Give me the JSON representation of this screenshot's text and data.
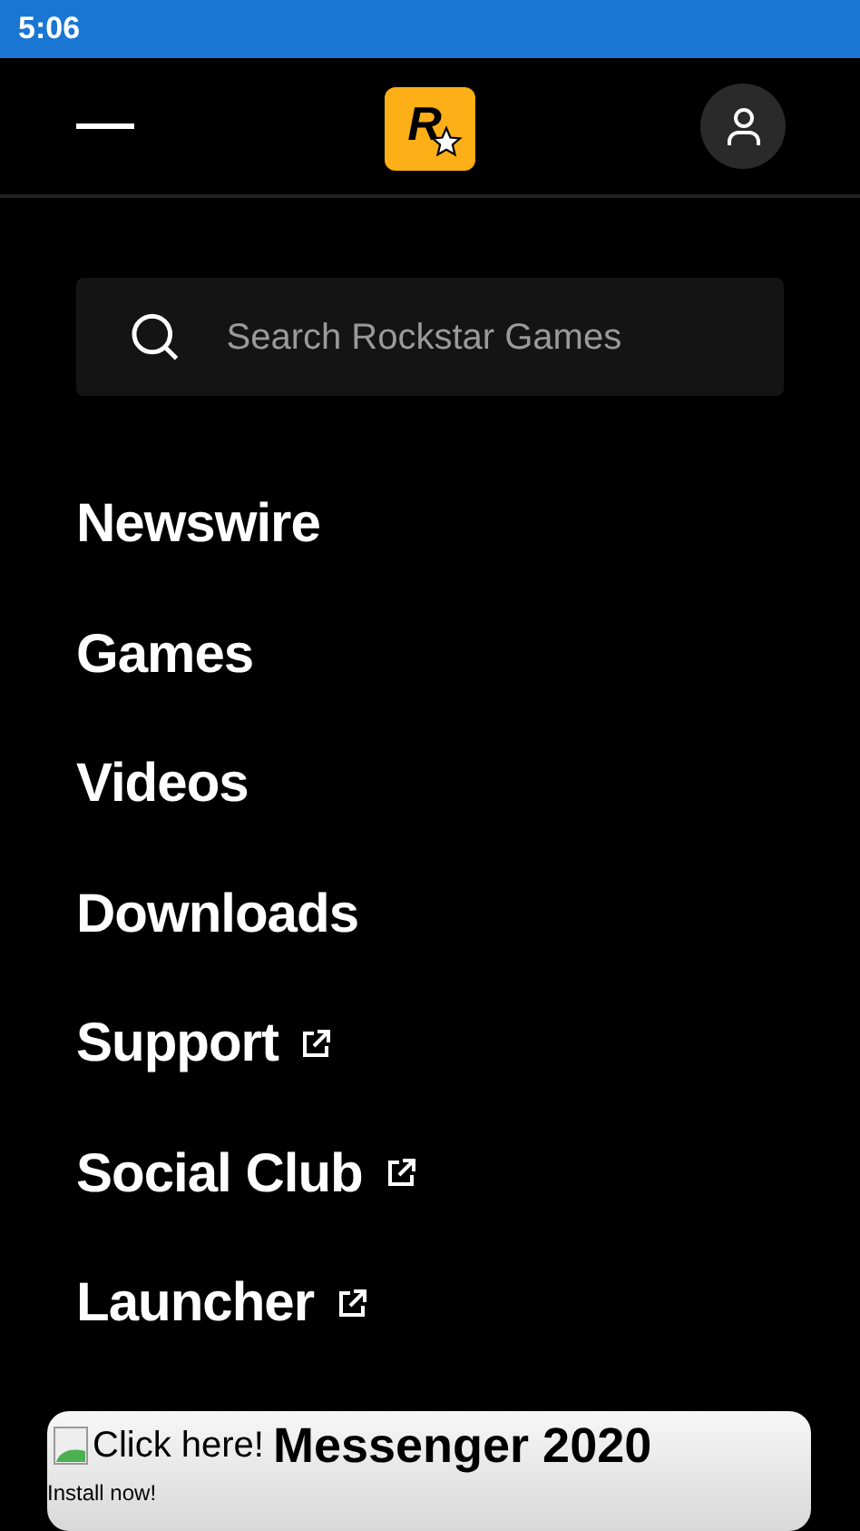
{
  "status_bar": {
    "time": "5:06"
  },
  "header": {
    "logo": "R"
  },
  "search": {
    "placeholder": "Search Rockstar Games"
  },
  "menu": [
    {
      "label": "Newswire",
      "external": false
    },
    {
      "label": "Games",
      "external": false
    },
    {
      "label": "Videos",
      "external": false
    },
    {
      "label": "Downloads",
      "external": false
    },
    {
      "label": "Support",
      "external": true
    },
    {
      "label": "Social Club",
      "external": true
    },
    {
      "label": "Launcher",
      "external": true
    }
  ],
  "ad": {
    "image_alt": "Click here!",
    "title": "Messenger 2020",
    "subtitle": "Install now!"
  }
}
